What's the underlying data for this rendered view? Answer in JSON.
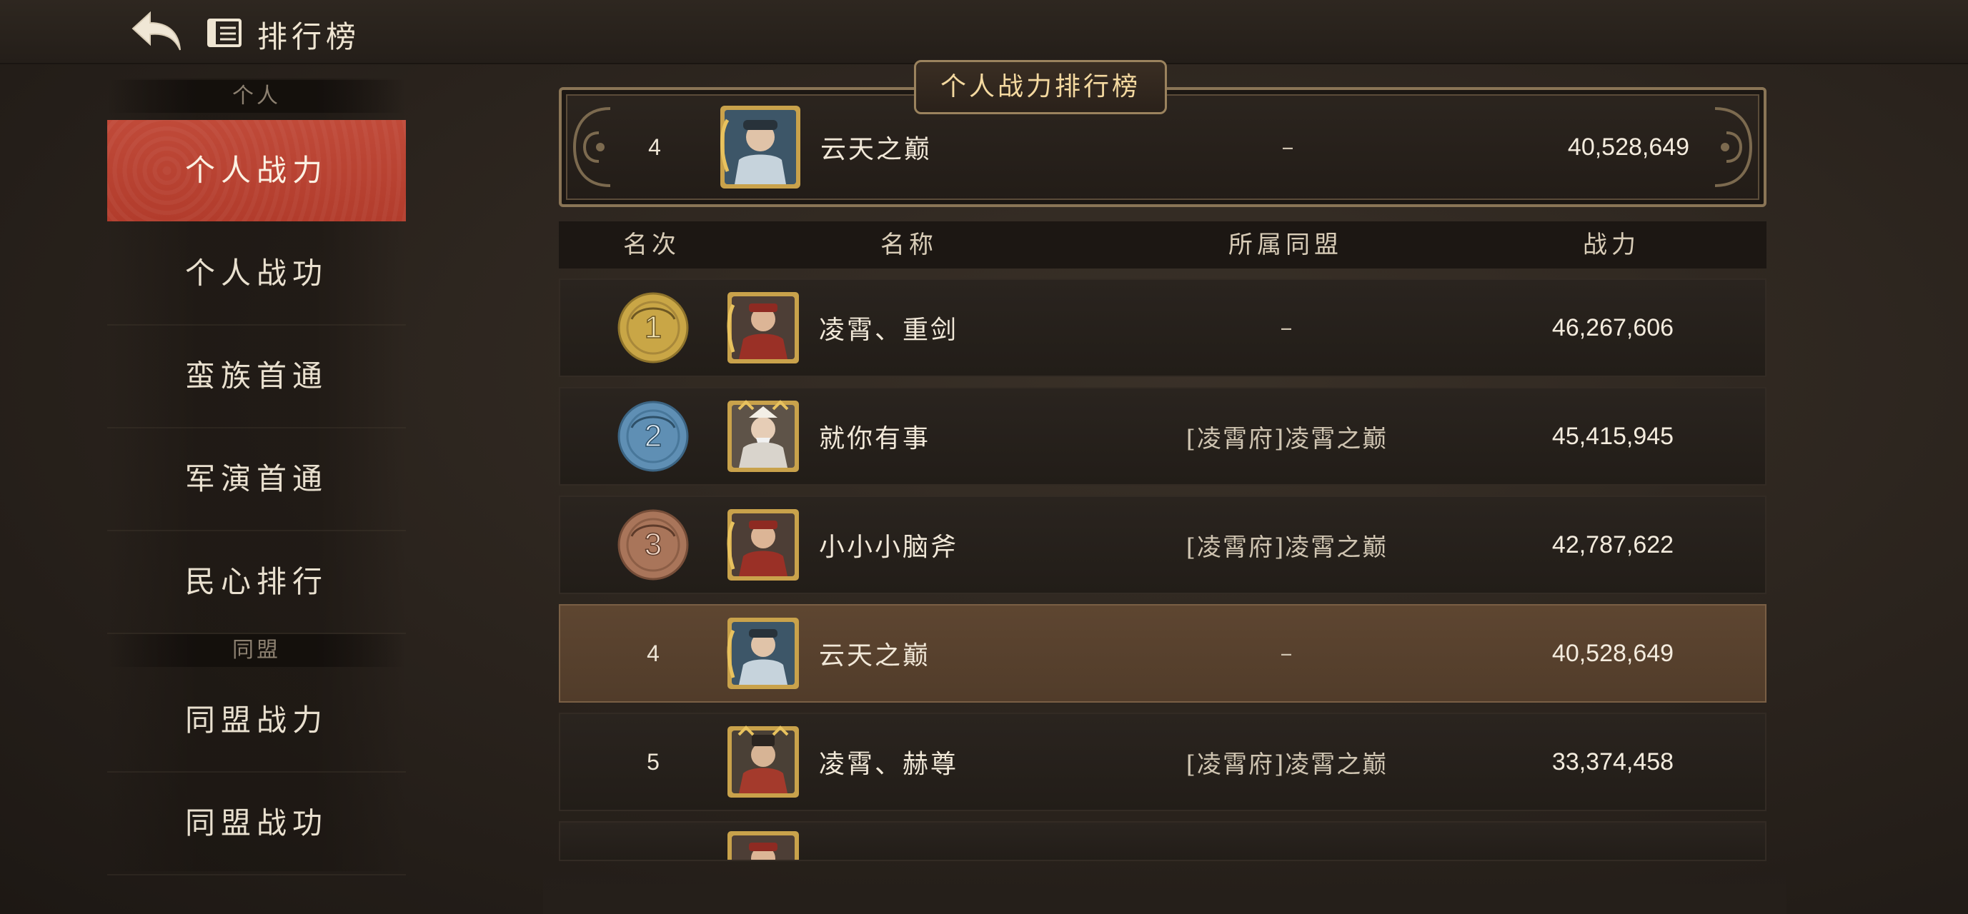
{
  "header": {
    "title": "排行榜",
    "back_icon": "back-arrow-icon",
    "book_icon": "ledger-icon"
  },
  "sidebar": {
    "sections": [
      {
        "label": "个人",
        "items": [
          "个人战力",
          "个人战功",
          "蛮族首通",
          "军演首通",
          "民心排行"
        ]
      },
      {
        "label": "同盟",
        "items": [
          "同盟战力",
          "同盟战功"
        ]
      }
    ],
    "active_item": "个人战力"
  },
  "panel": {
    "title": "个人战力排行榜",
    "my_rank": {
      "rank": "4",
      "name": "云天之巅",
      "alliance": "–",
      "power": "40,528,649"
    },
    "columns": [
      "名次",
      "名称",
      "所属同盟",
      "战力"
    ],
    "rows": [
      {
        "rank": "1",
        "medal": "gold",
        "name": "凌霄、重剑",
        "alliance": "–",
        "power": "46,267,606"
      },
      {
        "rank": "2",
        "medal": "silver",
        "name": "就你有事",
        "alliance": "[凌霄府]凌霄之巅",
        "power": "45,415,945"
      },
      {
        "rank": "3",
        "medal": "bronze",
        "name": "小小小脑斧",
        "alliance": "[凌霄府]凌霄之巅",
        "power": "42,787,622"
      },
      {
        "rank": "4",
        "medal": "",
        "name": "云天之巅",
        "alliance": "–",
        "power": "40,528,649",
        "highlight": true
      },
      {
        "rank": "5",
        "medal": "",
        "name": "凌霄、赫尊",
        "alliance": "[凌霄府]凌霄之巅",
        "power": "33,374,458"
      }
    ]
  },
  "colors": {
    "active_tab": "#b8412f",
    "gold_medal": "#c9a646",
    "silver_medal": "#5f8fb4",
    "bronze_medal": "#a9755a",
    "highlight_row": "#573f2c",
    "frame": "#8a7556"
  }
}
